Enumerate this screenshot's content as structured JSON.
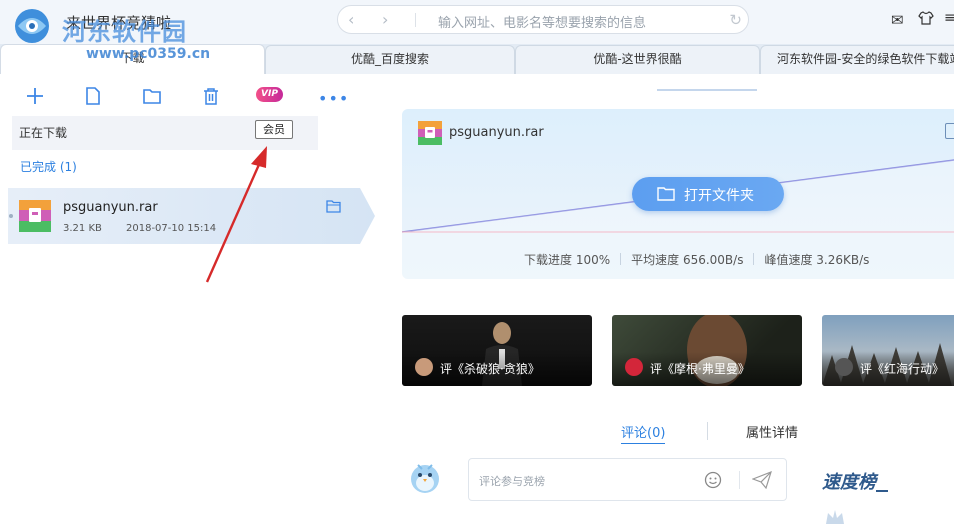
{
  "window": {
    "app_title": "来世界杯竞猜啦",
    "watermark_text": "河东软件园",
    "watermark_url": "www.pc0359.cn"
  },
  "address_bar": {
    "placeholder": "输入网址、电影名等想要搜索的信息"
  },
  "tabs": [
    {
      "label": "下载",
      "active": true
    },
    {
      "label": "优酷_百度搜索",
      "active": false
    },
    {
      "label": "优酷-这世界很酷",
      "active": false
    },
    {
      "label": "河东软件园-安全的绿色软件下载站",
      "active": false
    }
  ],
  "toolbar": {
    "icons": [
      "plus-icon",
      "new-file-icon",
      "folder-icon",
      "trash-icon",
      "vip-icon",
      "more-icon"
    ],
    "vip_label": "VIP",
    "more_label": "•••"
  },
  "downloads": {
    "downloading_label": "正在下载",
    "member_badge": "会员",
    "completed_label": "已完成 (1)",
    "items": [
      {
        "name": "psguanyun.rar",
        "size": "3.21 KB",
        "date": "2018-07-10 15:14"
      }
    ]
  },
  "detail_card": {
    "filename": "psguanyun.rar",
    "open_folder_label": "打开文件夹",
    "progress_text": "下载进度 100%",
    "avg_speed_text": "平均速度 656.00B/s",
    "peak_speed_text": "峰值速度 3.26KB/s",
    "progress_fraction": 1.0
  },
  "movies": [
    {
      "title": "评《杀破狼·贪狼》"
    },
    {
      "title": "评《摩根·弗里曼》"
    },
    {
      "title": "评《红海行动》"
    }
  ],
  "comments": {
    "comments_tab": "评论(0)",
    "props_tab": "属性详情",
    "input_placeholder": "评论参与竞榜",
    "speed_board": "速度榜"
  },
  "colors": {
    "accent": "#2c80e0",
    "button": "#5c9ef0",
    "arrow": "#d62a2a",
    "vip": "#e8408f"
  }
}
